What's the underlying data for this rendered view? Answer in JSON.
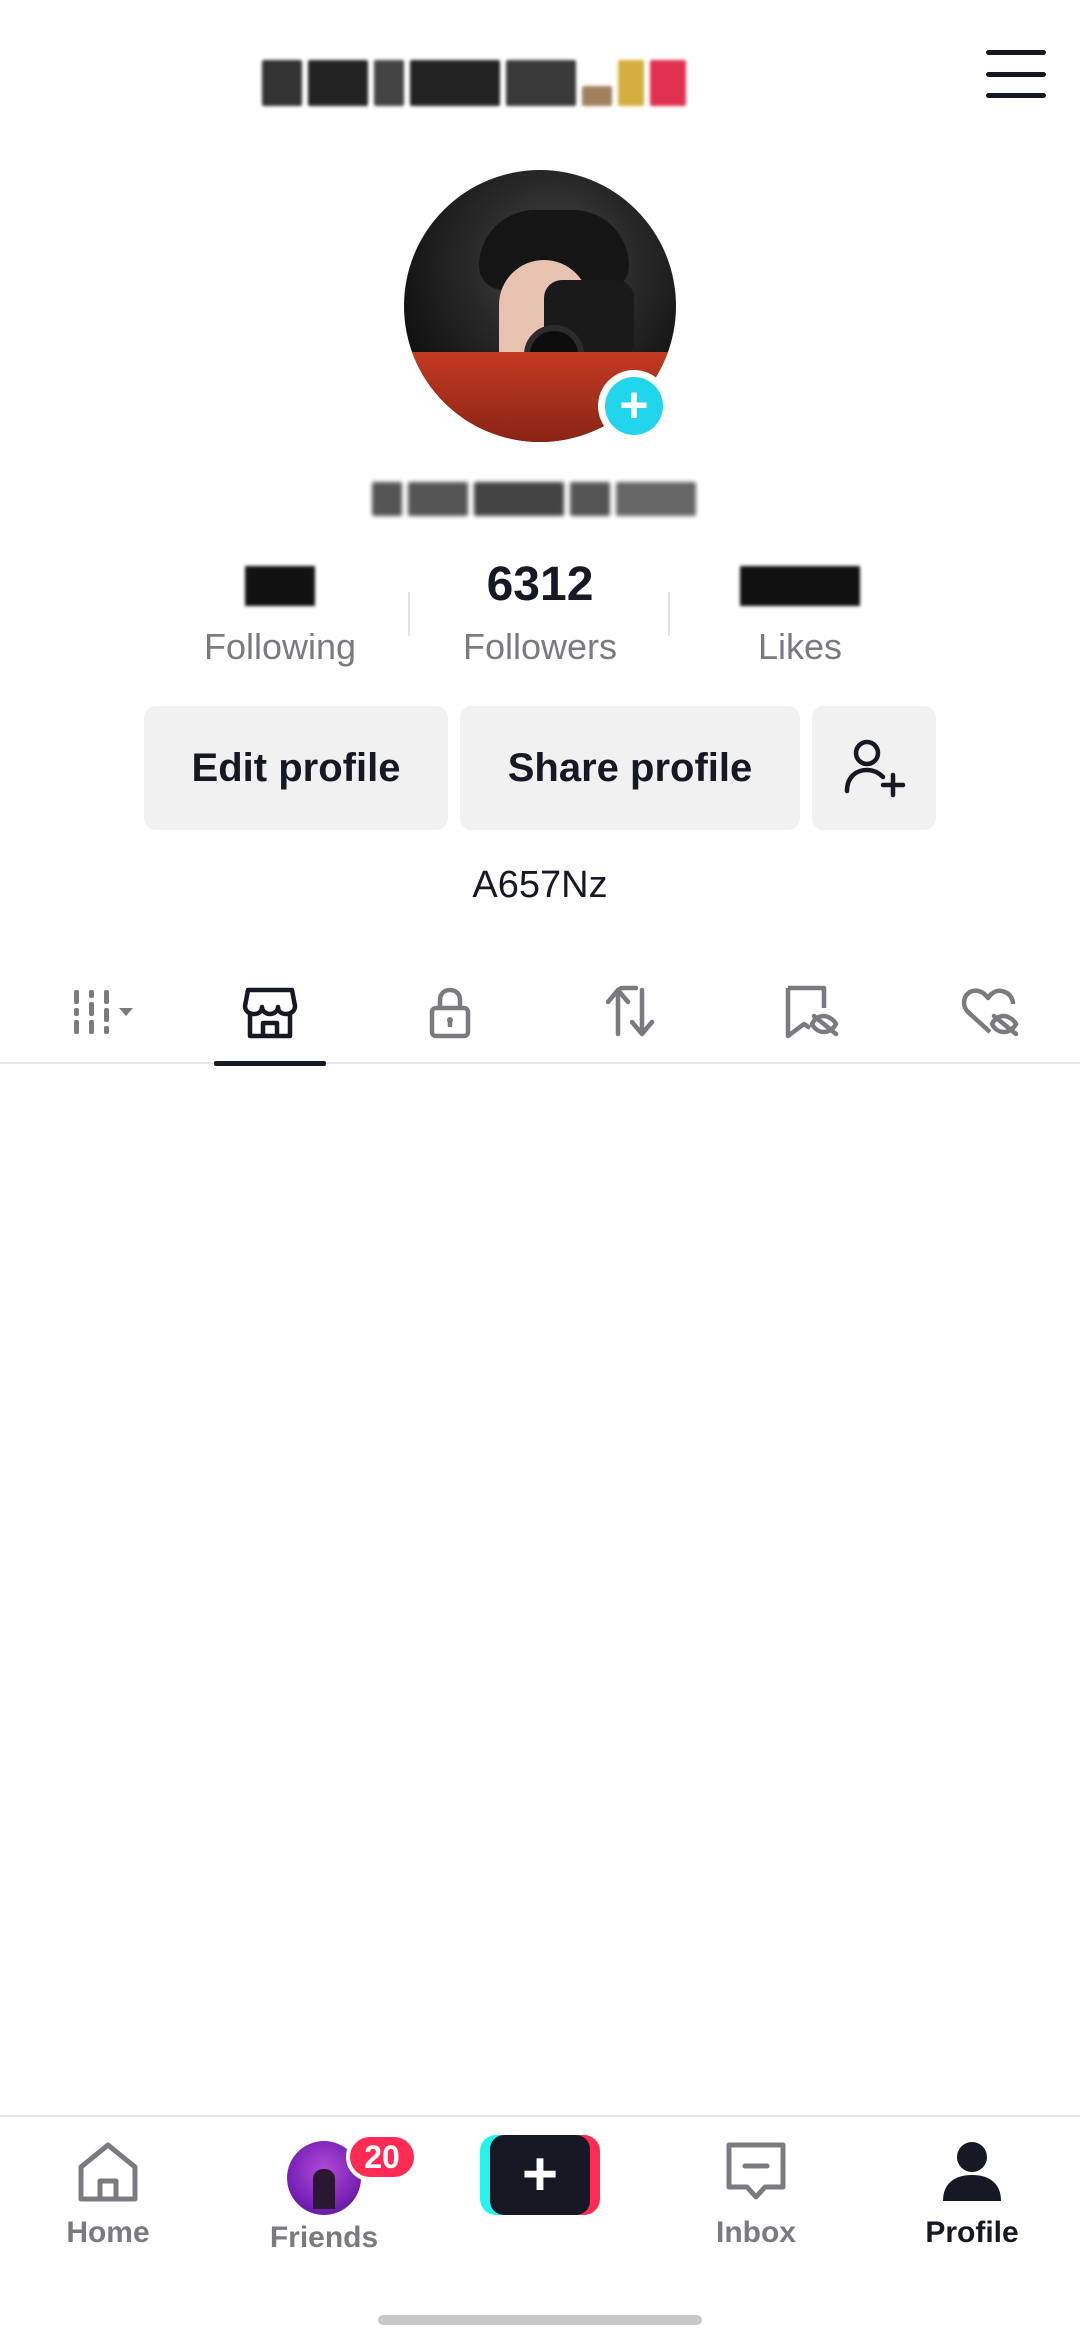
{
  "header": {
    "menu_icon": "hamburger-menu-icon"
  },
  "profile": {
    "add_avatar_icon": "plus-icon",
    "bio": "A657Nz"
  },
  "stats": {
    "following": {
      "label": "Following"
    },
    "followers": {
      "value": "6312",
      "label": "Followers"
    },
    "likes": {
      "label": "Likes"
    }
  },
  "actions": {
    "edit_label": "Edit profile",
    "share_label": "Share profile",
    "add_friend_icon": "add-person-icon"
  },
  "tabs": [
    {
      "icon": "grid-videos-icon",
      "active": false
    },
    {
      "icon": "shop-icon",
      "active": true
    },
    {
      "icon": "lock-icon",
      "active": false
    },
    {
      "icon": "repost-icon",
      "active": false
    },
    {
      "icon": "favorites-hidden-icon",
      "active": false
    },
    {
      "icon": "liked-hidden-icon",
      "active": false
    }
  ],
  "bottom_nav": {
    "home": {
      "label": "Home",
      "icon": "home-icon"
    },
    "friends": {
      "label": "Friends",
      "badge": "20"
    },
    "create": {
      "icon": "plus-icon"
    },
    "inbox": {
      "label": "Inbox",
      "icon": "inbox-icon"
    },
    "profile": {
      "label": "Profile",
      "icon": "person-icon"
    }
  },
  "colors": {
    "accent_cyan": "#20d5ec",
    "brand_red": "#fe2c55",
    "text": "#161823",
    "muted": "#7a7b80"
  }
}
